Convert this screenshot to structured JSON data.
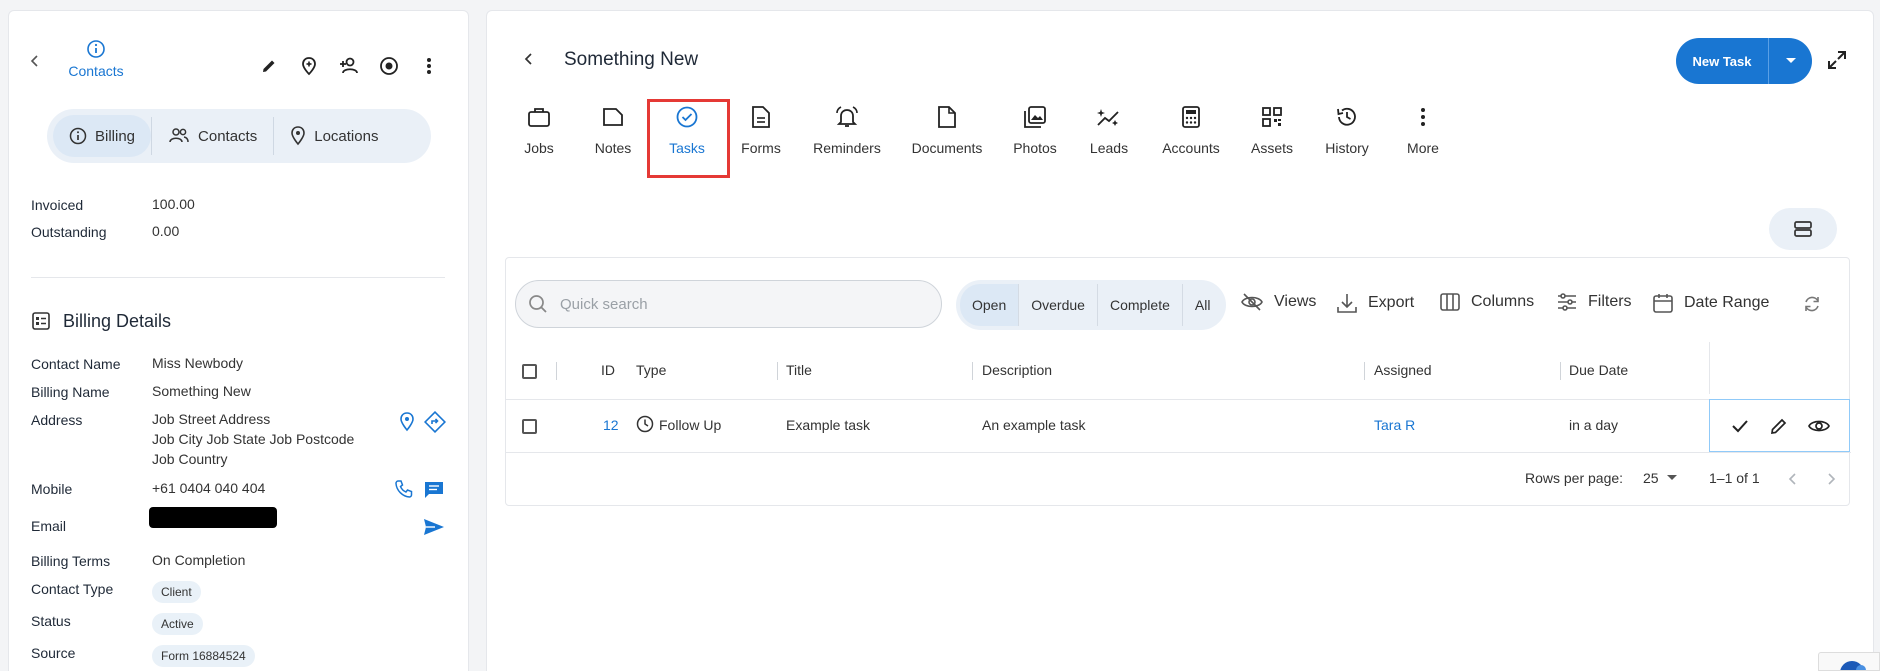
{
  "left": {
    "header": {
      "back_label": "Contacts"
    },
    "segment": {
      "items": [
        "Billing",
        "Contacts",
        "Locations"
      ],
      "active": "Billing"
    },
    "summary": [
      {
        "label": "Invoiced",
        "value": "100.00"
      },
      {
        "label": "Outstanding",
        "value": "0.00"
      }
    ],
    "billing_details": {
      "title": "Billing Details",
      "contact_name_label": "Contact Name",
      "contact_name": "Miss Newbody",
      "billing_name_label": "Billing Name",
      "billing_name": "Something New",
      "address_label": "Address",
      "address_line1": "Job Street Address",
      "address_line2": "Job City Job State Job Postcode",
      "address_line3": "Job Country",
      "mobile_label": "Mobile",
      "mobile": "+61 0404 040 404",
      "email_label": "Email",
      "billing_terms_label": "Billing Terms",
      "billing_terms": "On Completion",
      "contact_type_label": "Contact Type",
      "contact_type": "Client",
      "status_label": "Status",
      "status": "Active",
      "source_label": "Source",
      "source": "Form 16884524"
    }
  },
  "main": {
    "title": "Something New",
    "new_task_label": "New Task",
    "tabs": [
      "Jobs",
      "Notes",
      "Tasks",
      "Forms",
      "Reminders",
      "Documents",
      "Photos",
      "Leads",
      "Accounts",
      "Assets",
      "History",
      "More"
    ],
    "active_tab": "Tasks",
    "search": {
      "placeholder": "Quick search"
    },
    "status_filters": [
      "Open",
      "Overdue",
      "Complete",
      "All"
    ],
    "active_filter": "Open",
    "toolbar": {
      "views": "Views",
      "export": "Export",
      "columns": "Columns",
      "filters": "Filters",
      "date_range": "Date Range"
    },
    "table": {
      "columns": [
        "ID",
        "Type",
        "Title",
        "Description",
        "Assigned",
        "Due Date"
      ],
      "rows": [
        {
          "id": "12",
          "type": "Follow Up",
          "title": "Example task",
          "description": "An example task",
          "assigned": "Tara R",
          "due": "in a day"
        }
      ]
    },
    "pagination": {
      "rows_per_page_label": "Rows per page:",
      "rows_per_page": "25",
      "range": "1–1 of 1"
    }
  },
  "colors": {
    "accent": "#1976d2",
    "highlight": "#e53935",
    "chip_bg": "#e9f1f8"
  }
}
